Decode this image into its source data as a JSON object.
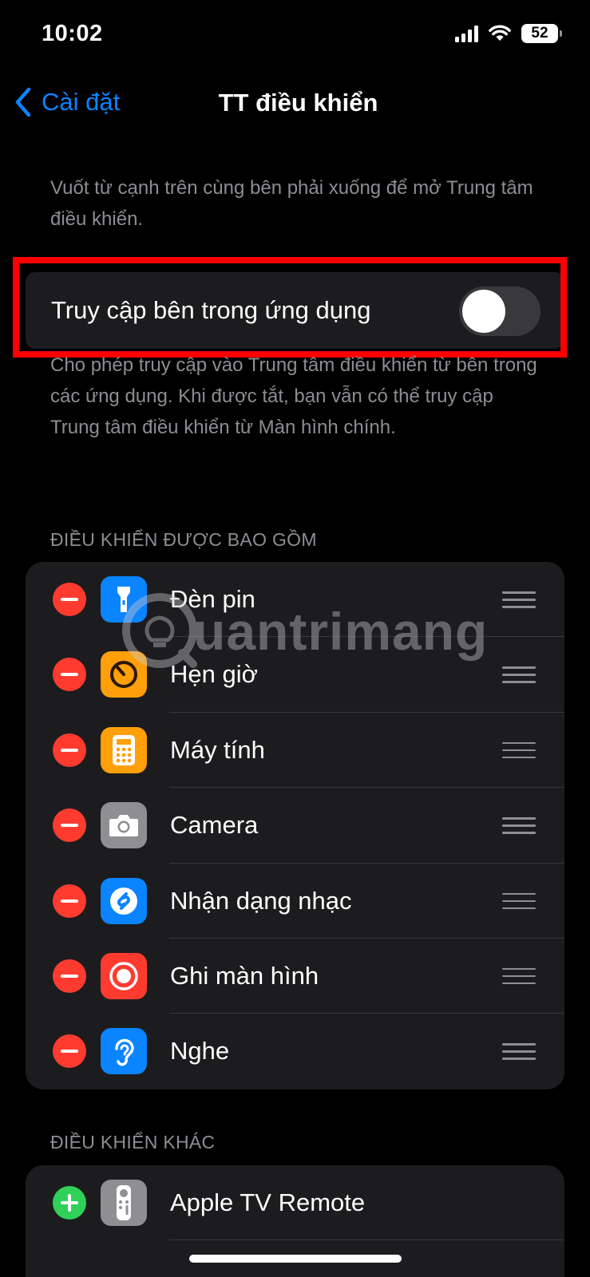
{
  "status_bar": {
    "time": "10:02",
    "battery": "52"
  },
  "nav": {
    "back_label": "Cài đặt",
    "title": "TT điều khiển"
  },
  "intro_text": "Vuốt từ cạnh trên cùng bên phải xuống để mở Trung tâm điều khiển.",
  "access_toggle": {
    "label": "Truy cập bên trong ứng dụng",
    "on": false
  },
  "access_footer": "Cho phép truy cập vào Trung tâm điều khiển từ bên trong các ứng dụng. Khi được tắt, bạn vẫn có thể truy cập Trung tâm điều khiển từ Màn hình chính.",
  "included": {
    "header": "ĐIỀU KHIỂN ĐƯỢC BAO GỒM",
    "items": [
      {
        "label": "Đèn pin",
        "icon": "flashlight-icon",
        "color": "#0a84ff"
      },
      {
        "label": "Hẹn giờ",
        "icon": "timer-icon",
        "color": "#ff9f0a"
      },
      {
        "label": "Máy tính",
        "icon": "calculator-icon",
        "color": "#ff9f0a"
      },
      {
        "label": "Camera",
        "icon": "camera-icon",
        "color": "#8e8e93"
      },
      {
        "label": "Nhận dạng nhạc",
        "icon": "shazam-icon",
        "color": "#0a84ff"
      },
      {
        "label": "Ghi màn hình",
        "icon": "screen-record-icon",
        "color": "#ff3b30"
      },
      {
        "label": "Nghe",
        "icon": "hearing-icon",
        "color": "#0a84ff"
      }
    ]
  },
  "more": {
    "header": "ĐIỀU KHIỂN KHÁC",
    "items": [
      {
        "label": "Apple TV Remote",
        "icon": "apple-tv-remote-icon",
        "color": "#8e8e93"
      }
    ]
  },
  "watermark": "uantrimang",
  "colors": {
    "accent": "#0a84ff",
    "remove": "#ff3b30",
    "add": "#30d158",
    "highlight": "#ff0000"
  }
}
